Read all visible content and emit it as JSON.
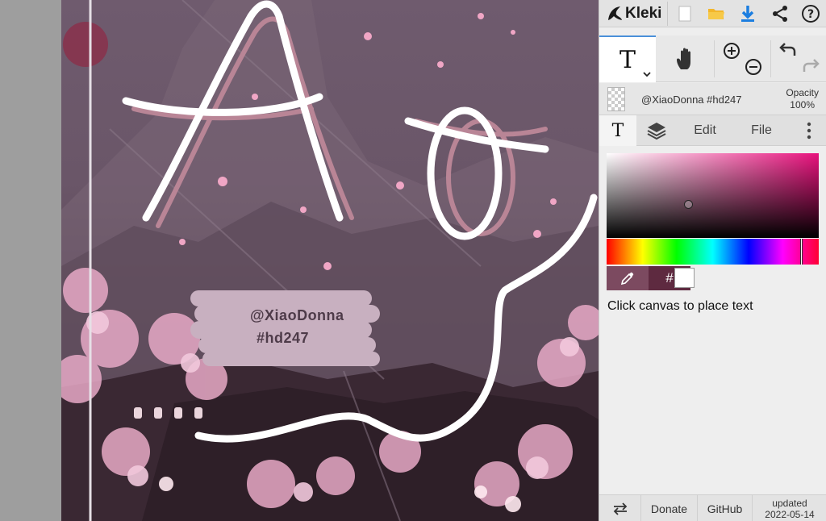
{
  "canvas": {
    "title_text": "Ao",
    "watermark_line1": "@XiaoDonna",
    "watermark_line2": "#hd247"
  },
  "app": {
    "name": "Kleki",
    "icons": [
      "new-image-icon",
      "open-folder-icon",
      "download-icon",
      "share-icon",
      "help-icon"
    ]
  },
  "tools": {
    "text_tool_label": "T",
    "icons": [
      "text-tool-icon",
      "hand-tool-icon",
      "zoom-in-icon",
      "zoom-out-icon",
      "undo-icon",
      "redo-icon"
    ]
  },
  "layer": {
    "name": "@XiaoDonna #hd247",
    "opacity_label": "Opacity",
    "opacity_value": "100%"
  },
  "tabs": {
    "text": "T",
    "edit": "Edit",
    "file": "File"
  },
  "color": {
    "hue": "#e8127d",
    "hex_button": "#",
    "secondary": "#ffffff"
  },
  "hint": "Click canvas to place text",
  "footer": {
    "donate": "Donate",
    "github": "GitHub",
    "updated_label": "updated",
    "updated_date": "2022-05-14"
  }
}
